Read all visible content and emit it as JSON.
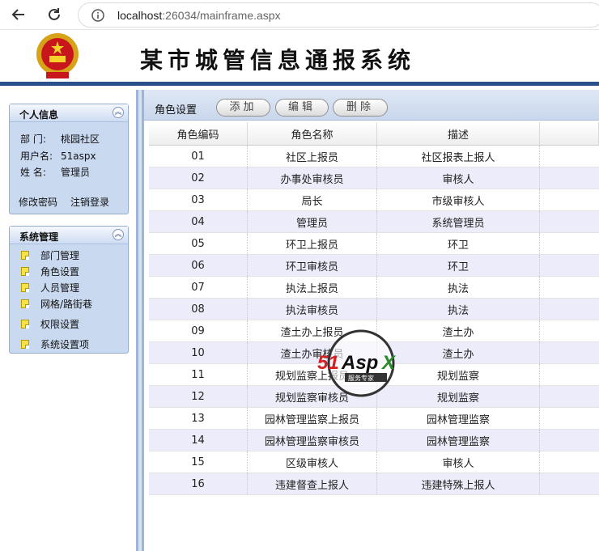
{
  "browser": {
    "url_host": "localhost",
    "url_port": ":26034",
    "url_path": "/mainframe.aspx"
  },
  "header": {
    "title": "某市城管信息通报系统"
  },
  "personal_panel": {
    "title": "个人信息",
    "rows": [
      {
        "label": "部  门:",
        "value": "桃园社区"
      },
      {
        "label": "用户名:",
        "value": "51aspx"
      },
      {
        "label": "姓  名:",
        "value": "管理员"
      }
    ],
    "change_password": "修改密码",
    "logout": "注销登录"
  },
  "system_panel": {
    "title": "系统管理",
    "items": [
      "部门管理",
      "角色设置",
      "人员管理",
      "网格/路街巷",
      "权限设置",
      "系统设置项"
    ]
  },
  "toolbar": {
    "title": "角色设置",
    "add": "添加",
    "edit": "编辑",
    "delete": "删除"
  },
  "grid": {
    "columns": [
      "角色编码",
      "角色名称",
      "描述"
    ],
    "rows": [
      [
        "01",
        "社区上报员",
        "社区报表上报人"
      ],
      [
        "02",
        "办事处审核员",
        "审核人"
      ],
      [
        "03",
        "局长",
        "市级审核人"
      ],
      [
        "04",
        "管理员",
        "系统管理员"
      ],
      [
        "05",
        "环卫上报员",
        "环卫"
      ],
      [
        "06",
        "环卫审核员",
        "环卫"
      ],
      [
        "07",
        "执法上报员",
        "执法"
      ],
      [
        "08",
        "执法审核员",
        "执法"
      ],
      [
        "09",
        "渣土办上报员",
        "渣土办"
      ],
      [
        "10",
        "渣土办审核员",
        "渣土办"
      ],
      [
        "11",
        "规划监察上报员",
        "规划监察"
      ],
      [
        "12",
        "规划监察审核员",
        "规划监察"
      ],
      [
        "13",
        "园林管理监察上报员",
        "园林管理监察"
      ],
      [
        "14",
        "园林管理监察审核员",
        "园林管理监察"
      ],
      [
        "15",
        "区级审核人",
        "审核人"
      ],
      [
        "16",
        "违建督查上报人",
        "违建特殊上报人"
      ]
    ]
  },
  "watermark": {
    "brand": "51Aspx",
    "tagline": "服务专家"
  },
  "colors": {
    "header_rule": "#2b4f8a",
    "panel_bg": "#c9d9f0",
    "row_alt": "#ececfa"
  }
}
